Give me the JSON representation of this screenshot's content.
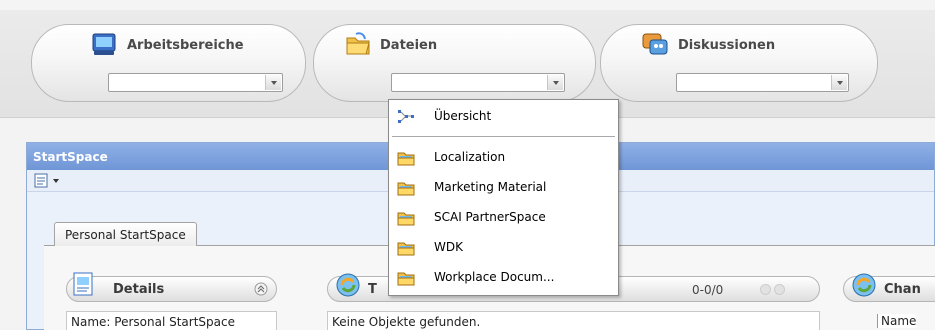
{
  "nav": {
    "workspaces": {
      "title": "Arbeitsbereiche",
      "selected": ""
    },
    "files": {
      "title": "Dateien",
      "selected": ""
    },
    "discussions": {
      "title": "Diskussionen",
      "selected": ""
    }
  },
  "files_menu": {
    "overview": "Übersicht",
    "items": [
      "Localization",
      "Marketing Material",
      "SCAI PartnerSpace",
      "WDK",
      "Workplace Docum..."
    ]
  },
  "panel": {
    "title": "StartSpace",
    "tab_label": "Personal StartSpace"
  },
  "portlets": {
    "details": {
      "title": "Details",
      "name_line": "Name: Personal StartSpace"
    },
    "tasks": {
      "title": "T",
      "count": "0-0/0",
      "empty": "Keine Objekte gefunden."
    },
    "changes": {
      "title": "Chan",
      "column": "Name"
    }
  }
}
